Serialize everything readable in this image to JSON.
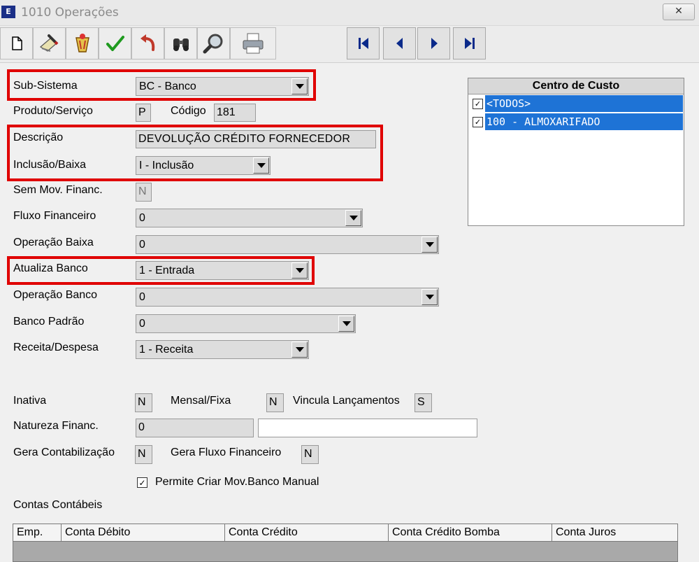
{
  "window": {
    "title": "1010 Operações",
    "close_symbol": "✕",
    "app_icon_text": "E"
  },
  "toolbar": {
    "buttons": [
      {
        "name": "new-document-icon"
      },
      {
        "name": "edit-icon"
      },
      {
        "name": "delete-icon"
      },
      {
        "name": "confirm-check-icon"
      },
      {
        "name": "undo-icon"
      },
      {
        "name": "search-binoculars-icon"
      },
      {
        "name": "magnifier-icon"
      },
      {
        "name": "print-icon"
      }
    ],
    "nav": [
      {
        "name": "first-record-icon"
      },
      {
        "name": "previous-record-icon"
      },
      {
        "name": "next-record-icon"
      },
      {
        "name": "last-record-icon"
      }
    ]
  },
  "form": {
    "sub_sistema": {
      "label": "Sub-Sistema",
      "value": "BC - Banco"
    },
    "produto_servico": {
      "label": "Produto/Serviço",
      "value": "P"
    },
    "codigo": {
      "label": "Código",
      "value": "181"
    },
    "descricao": {
      "label": "Descrição",
      "value": "DEVOLUÇÃO CRÉDITO FORNECEDOR"
    },
    "inclusao_baixa": {
      "label": "Inclusão/Baixa",
      "value": "I - Inclusão"
    },
    "sem_mov_financ": {
      "label": "Sem Mov. Financ.",
      "value": "N"
    },
    "fluxo_financeiro": {
      "label": "Fluxo Financeiro",
      "value": "0"
    },
    "operacao_baixa": {
      "label": "Operação Baixa",
      "value": "0"
    },
    "atualiza_banco": {
      "label": "Atualiza Banco",
      "value": "1 - Entrada"
    },
    "operacao_banco": {
      "label": "Operação Banco",
      "value": "0"
    },
    "banco_padrao": {
      "label": "Banco Padrão",
      "value": "0"
    },
    "receita_despesa": {
      "label": "Receita/Despesa",
      "value": "1 - Receita"
    },
    "inativa": {
      "label": "Inativa",
      "value": "N"
    },
    "mensal_fixa": {
      "label": "Mensal/Fixa",
      "value": "N"
    },
    "vincula_lancamentos": {
      "label": "Vincula Lançamentos",
      "value": "S"
    },
    "natureza_financ": {
      "label": "Natureza Financ.",
      "value": "0",
      "description": ""
    },
    "gera_contabilizacao": {
      "label": "Gera Contabilização",
      "value": "N"
    },
    "gera_fluxo_financeiro": {
      "label": "Gera Fluxo Financeiro",
      "value": "N"
    },
    "permite_criar_mov": {
      "label": "Permite Criar Mov.Banco Manual",
      "checked": true,
      "mark": "✓"
    },
    "contas_contabeis": {
      "label": "Contas Contábeis"
    }
  },
  "centro_de_custo": {
    "title": "Centro de Custo",
    "items": [
      {
        "label": "<TODOS>",
        "checked": true,
        "mark": "✓"
      },
      {
        "label": "100 - ALMOXARIFADO",
        "checked": true,
        "mark": "✓"
      }
    ]
  },
  "contas_grid": {
    "columns": [
      "Emp.",
      "Conta Débito",
      "Conta Crédito",
      "Conta Crédito Bomba",
      "Conta Juros"
    ]
  },
  "colors": {
    "highlight_border": "#e00000",
    "selection": "#1e73d6"
  }
}
